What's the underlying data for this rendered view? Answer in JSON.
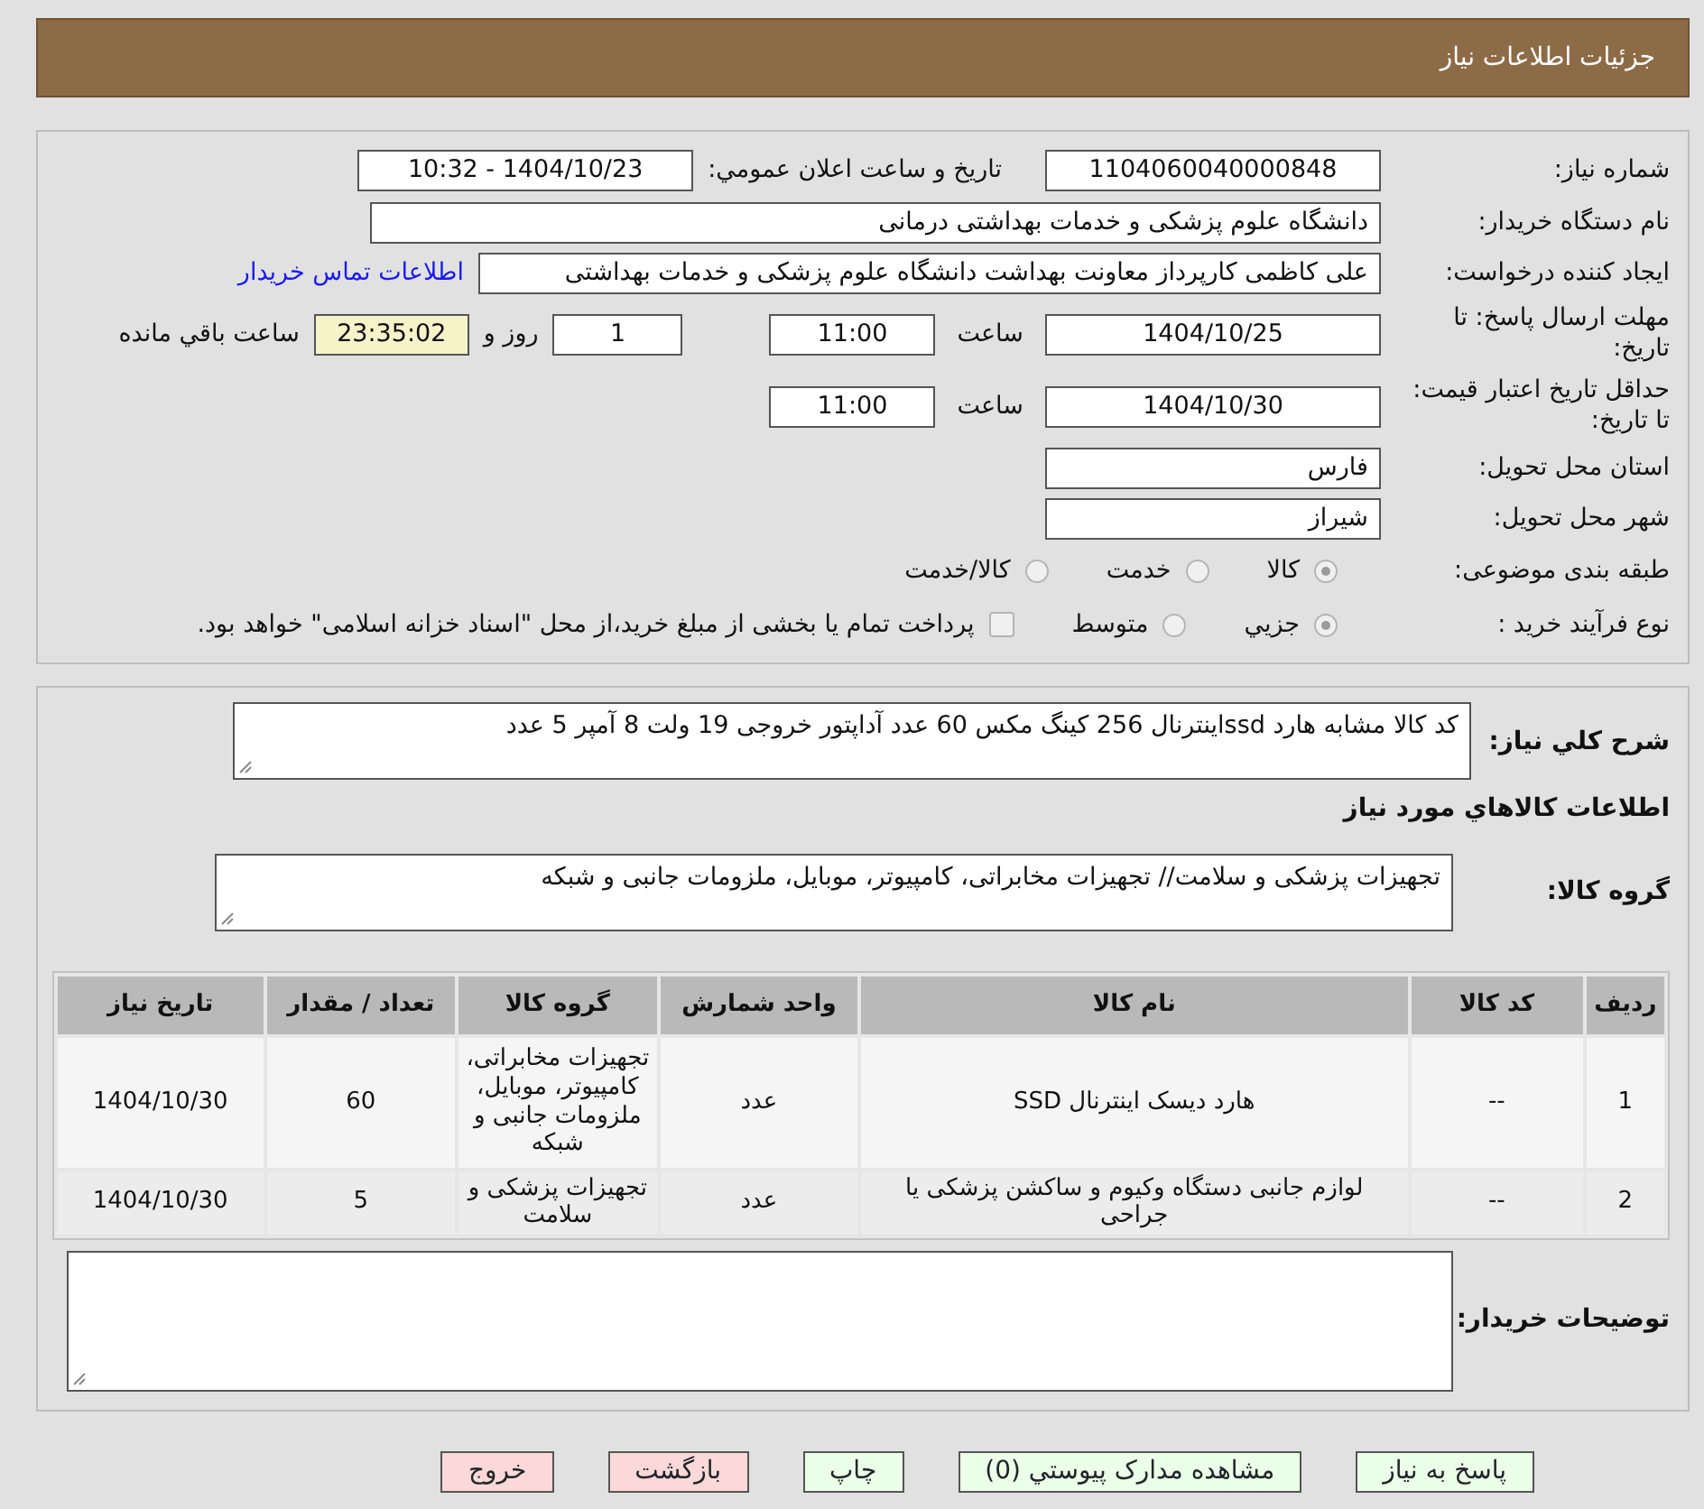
{
  "header": {
    "title": "جزئیات اطلاعات نیاز"
  },
  "info": {
    "need_number": {
      "label": "شماره نیاز:",
      "value": "1104060040000848"
    },
    "announce": {
      "label": "تاریخ و ساعت اعلان عمومي:",
      "value": "1404/10/23 - 10:32"
    },
    "buyer": {
      "label": "نام دستگاه خریدار:",
      "value": "دانشگاه علوم پزشکی و خدمات بهداشتی درمانی"
    },
    "requester": {
      "label": "ایجاد کننده درخواست:",
      "value": "علی کاظمی کارپرداز معاونت بهداشت دانشگاه علوم پزشکی و خدمات بهداشتی",
      "link": "اطلاعات تماس خریدار"
    },
    "deadline": {
      "label": "مهلت ارسال پاسخ: تا تاریخ:",
      "date": "1404/10/25",
      "time_label": "ساعت",
      "time": "11:00",
      "days": "1",
      "days_label": "روز و",
      "remaining": "23:35:02",
      "remaining_label": "ساعت باقي مانده"
    },
    "validity": {
      "label": "حداقل تاریخ اعتبار قیمت: تا تاریخ:",
      "date": "1404/10/30",
      "time_label": "ساعت",
      "time": "11:00"
    },
    "province": {
      "label": "استان محل تحویل:",
      "value": "فارس"
    },
    "city": {
      "label": "شهر محل تحویل:",
      "value": "شیراز"
    },
    "category": {
      "label": "طبقه بندی موضوعی:",
      "options": [
        {
          "label": "کالا",
          "selected": true
        },
        {
          "label": "خدمت",
          "selected": false
        },
        {
          "label": "کالا/خدمت",
          "selected": false
        }
      ]
    },
    "process": {
      "label": "نوع فرآیند خرید :",
      "options": [
        {
          "label": "جزيي",
          "selected": true
        },
        {
          "label": "متوسط",
          "selected": false
        }
      ],
      "treasury": {
        "label": "پرداخت تمام یا بخشی از مبلغ خرید،از محل \"اسناد خزانه اسلامی\" خواهد بود.",
        "checked": false
      }
    }
  },
  "details": {
    "description": {
      "label": "شرح كلي نیاز:",
      "value": "کد کالا مشابه هارد ssdاینترنال 256 کینگ مکس 60 عدد آداپتور خروجی 19 ولت 8 آمپر 5 عدد"
    },
    "heading": "اطلاعات كالاهاي مورد نیاز",
    "group": {
      "label": "گروه کالا:",
      "value": "تجهیزات پزشکی و سلامت// تجهیزات مخابراتی، کامپیوتر، موبایل، ملزومات جانبی و شبکه"
    },
    "table": {
      "columns": [
        "ردیف",
        "کد کالا",
        "نام کالا",
        "واحد شمارش",
        "گروه کالا",
        "تعداد / مقدار",
        "تاریخ نیاز"
      ],
      "rows": [
        [
          "1",
          "--",
          "هارد دیسک اینترنال SSD",
          "عدد",
          "تجهیزات مخابراتی، کامپیوتر، موبایل، ملزومات جانبی و شبکه",
          "60",
          "1404/10/30"
        ],
        [
          "2",
          "--",
          "لوازم جانبی دستگاه وکیوم و ساکشن پزشکی یا جراحی",
          "عدد",
          "تجهیزات پزشکی و سلامت",
          "5",
          "1404/10/30"
        ]
      ]
    },
    "notes": {
      "label": "توضیحات خریدار:"
    }
  },
  "buttons": [
    {
      "label": "پاسخ به نیاز",
      "kind": "action"
    },
    {
      "label": "مشاهده مدارک پیوستي (0)",
      "kind": "action"
    },
    {
      "label": "چاپ",
      "kind": "action"
    },
    {
      "label": "بازگشت",
      "kind": "exit"
    },
    {
      "label": "خروج",
      "kind": "exit"
    }
  ]
}
